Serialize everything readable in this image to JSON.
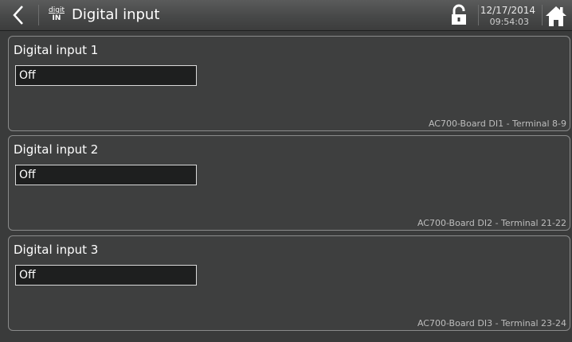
{
  "header": {
    "title": "Digital input",
    "module_icon": {
      "top": "digit",
      "bottom": "IN",
      "name": "digit-in-icon"
    },
    "date": "12/17/2014",
    "time": "09:54:03",
    "icons": {
      "back": "chevron-left-icon",
      "lock": "unlocked-padlock-icon",
      "home": "home-icon"
    }
  },
  "inputs": [
    {
      "title": "Digital input 1",
      "value": "Off",
      "hardware": "AC700-Board  DI1 - Terminal 8-9"
    },
    {
      "title": "Digital input 2",
      "value": "Off",
      "hardware": "AC700-Board  DI2 - Terminal 21-22"
    },
    {
      "title": "Digital input 3",
      "value": "Off",
      "hardware": "AC700-Board  DI3 - Terminal 23-24"
    }
  ],
  "colors": {
    "background": "#3a3b3b",
    "panel_border": "#8a8b8b",
    "value_bg": "#1e1f1f"
  }
}
